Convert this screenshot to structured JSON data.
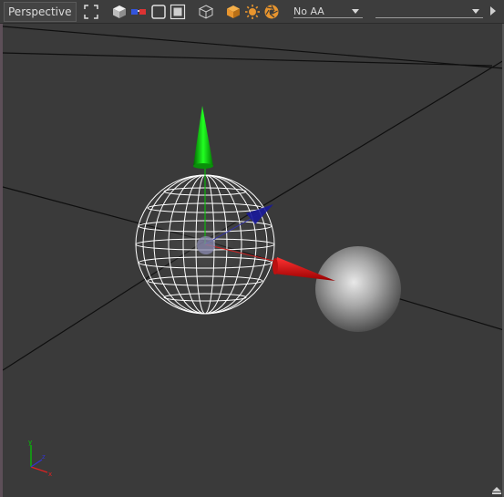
{
  "toolbar": {
    "view_label": "Perspective",
    "antialias": {
      "selected": "No AA"
    },
    "camera": {
      "selected": ""
    },
    "icons": [
      "frame-selection-icon",
      "shaded-cube-icon",
      "stereo-glasses-icon",
      "wire-box-icon",
      "safe-frame-icon",
      "outline-cube-icon",
      "lit-cube-icon",
      "sun-light-icon",
      "aperture-icon"
    ]
  },
  "scene": {
    "objects": [
      "wireframe-sphere",
      "shaded-sphere"
    ],
    "gizmo": [
      "y-axis-handle",
      "x-axis-handle",
      "z-axis-handle"
    ],
    "axis_indicator": [
      "x",
      "y",
      "z"
    ]
  },
  "colors": {
    "background": "#3a3a3a",
    "toolbar": "#3d3d3d",
    "accent_orange": "#e8952e",
    "axis_x": "#ff0000",
    "axis_y": "#00dd00",
    "axis_z": "#1a1aaa"
  }
}
